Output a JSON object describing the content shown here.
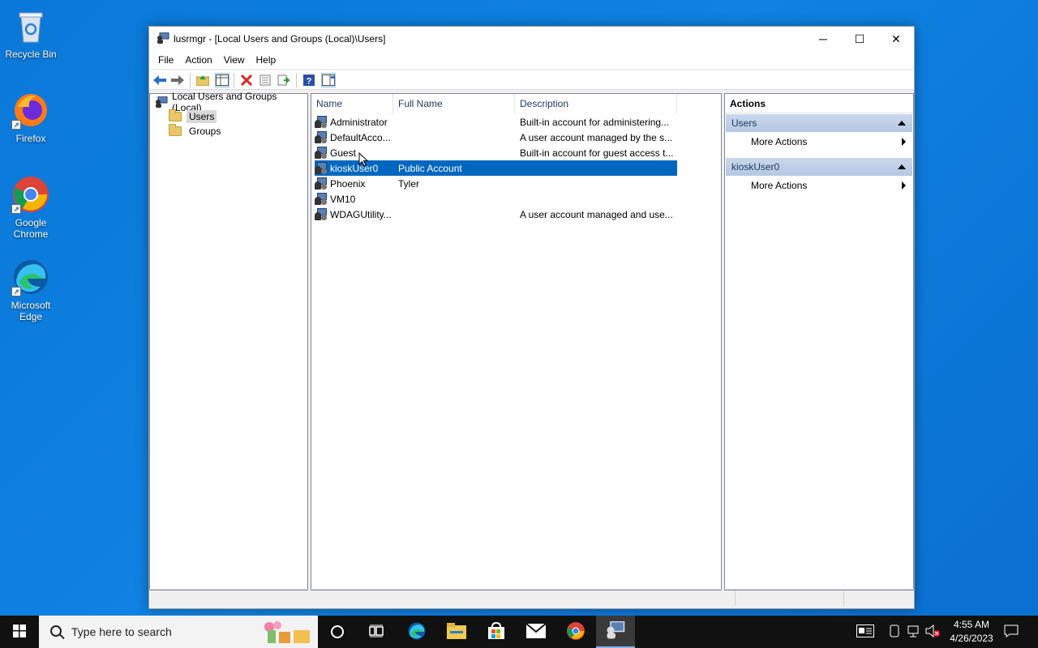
{
  "desktop": {
    "icons": [
      {
        "label": "Recycle Bin",
        "icon": "recycle-bin-icon"
      },
      {
        "label": "Firefox",
        "icon": "firefox-icon"
      },
      {
        "label": "Google Chrome",
        "icon": "chrome-icon"
      },
      {
        "label": "Microsoft Edge",
        "icon": "edge-icon"
      }
    ]
  },
  "window": {
    "title": "lusrmgr - [Local Users and Groups (Local)\\Users]",
    "controls": {
      "minimize": "─",
      "maximize": "☐",
      "close": "✕"
    }
  },
  "menu": {
    "items": [
      "File",
      "Action",
      "View",
      "Help"
    ]
  },
  "tree": {
    "root": "Local Users and Groups (Local)",
    "children": [
      {
        "label": "Users",
        "selected": true
      },
      {
        "label": "Groups",
        "selected": false
      }
    ]
  },
  "list": {
    "columns": [
      "Name",
      "Full Name",
      "Description"
    ],
    "rows": [
      {
        "name": "Administrator",
        "full_name": "",
        "description": "Built-in account for administering..."
      },
      {
        "name": "DefaultAcco...",
        "full_name": "",
        "description": "A user account managed by the s..."
      },
      {
        "name": "Guest",
        "full_name": "",
        "description": "Built-in account for guest access t..."
      },
      {
        "name": "kioskUser0",
        "full_name": "Public Account",
        "description": "",
        "selected": true
      },
      {
        "name": "Phoenix",
        "full_name": "Tyler",
        "description": ""
      },
      {
        "name": "VM10",
        "full_name": "",
        "description": ""
      },
      {
        "name": "WDAGUtility...",
        "full_name": "",
        "description": "A user account managed and use..."
      }
    ]
  },
  "actions": {
    "header": "Actions",
    "sections": [
      {
        "title": "Users",
        "items": [
          "More Actions"
        ]
      },
      {
        "title": "kioskUser0",
        "items": [
          "More Actions"
        ]
      }
    ]
  },
  "taskbar": {
    "search_placeholder": "Type here to search",
    "clock": {
      "time": "4:55 AM",
      "date": "4/26/2023"
    }
  },
  "colors": {
    "selection": "#0067c0",
    "desktop": "#0a78d8",
    "taskbar": "#111111"
  }
}
